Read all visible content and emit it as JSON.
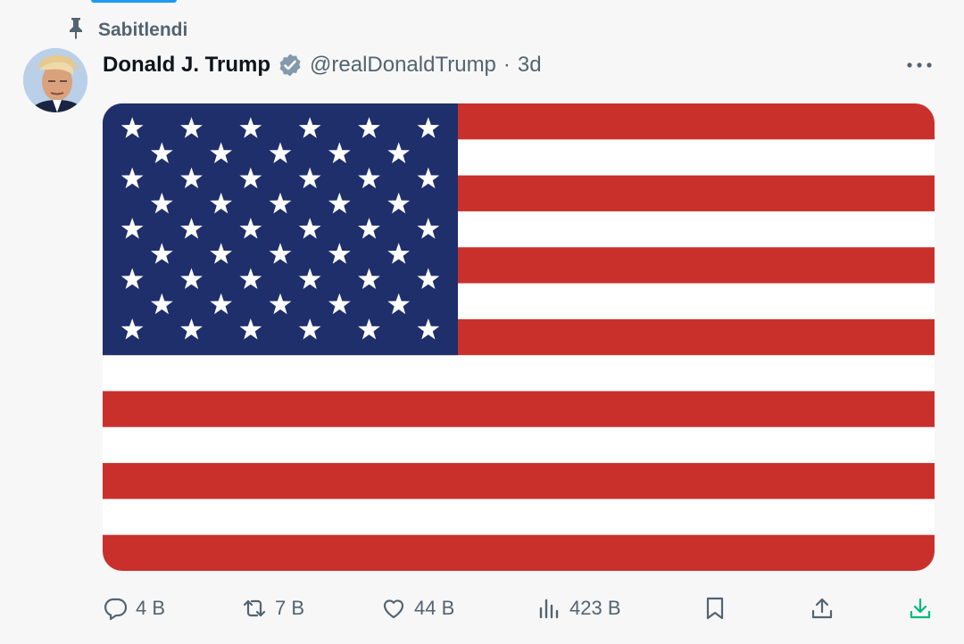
{
  "pinned": {
    "label": "Sabitlendi",
    "icon": "pin-icon"
  },
  "post": {
    "author": {
      "display_name": "Donald J. Trump",
      "verified": true,
      "handle": "@realDonaldTrump",
      "separator": "·",
      "time": "3d"
    },
    "media": {
      "description_icon": "us-flag-image",
      "stars_rows": 9
    }
  },
  "actions": {
    "reply": {
      "count": "4 B",
      "icon": "reply-icon"
    },
    "repost": {
      "count": "7 B",
      "icon": "repost-icon"
    },
    "like": {
      "count": "44 B",
      "icon": "heart-icon"
    },
    "views": {
      "count": "423 B",
      "icon": "analytics-icon"
    },
    "bookmark": {
      "icon": "bookmark-icon"
    },
    "share": {
      "icon": "share-icon"
    },
    "download": {
      "icon": "download-icon"
    }
  },
  "colors": {
    "accent": "#1d9bf0",
    "muted": "#536471",
    "flag_red": "#c9302c",
    "flag_blue": "#1f2f6b",
    "download_green": "#00ba7c"
  }
}
